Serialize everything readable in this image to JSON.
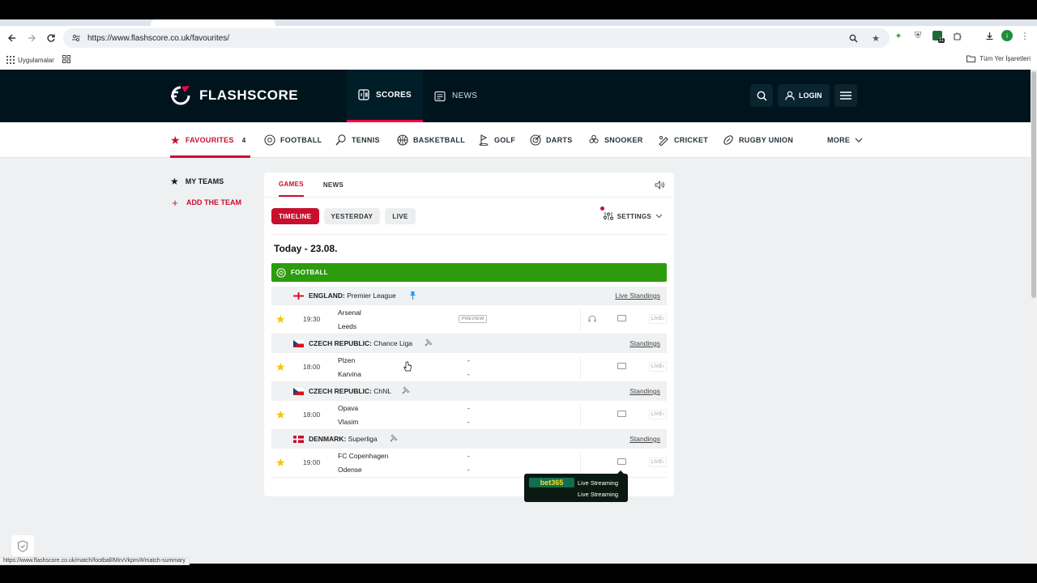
{
  "browser": {
    "url": "https://www.flashscore.co.uk/favourites/",
    "bookmarks_apps": "Uygulamalar",
    "bookmarks_all": "Tüm Yer İşaretleri",
    "extension_badge": "11",
    "profile_initial": "i",
    "status_url": "https://www.flashscore.co.uk/match/football/MirvVkpm/#/match-summary"
  },
  "header": {
    "logo_text": "FLASHSCORE",
    "nav": [
      {
        "label": "SCORES",
        "icon": "scoreboard-icon",
        "active": true
      },
      {
        "label": "NEWS",
        "icon": "news-icon",
        "active": false
      }
    ],
    "login_label": "LOGIN"
  },
  "sports": [
    {
      "label": "FAVOURITES",
      "icon": "star-icon",
      "count": "4"
    },
    {
      "label": "FOOTBALL",
      "icon": "football-icon"
    },
    {
      "label": "TENNIS",
      "icon": "tennis-icon"
    },
    {
      "label": "BASKETBALL",
      "icon": "basketball-icon"
    },
    {
      "label": "GOLF",
      "icon": "golf-icon"
    },
    {
      "label": "DARTS",
      "icon": "darts-icon"
    },
    {
      "label": "SNOOKER",
      "icon": "snooker-icon"
    },
    {
      "label": "CRICKET",
      "icon": "cricket-icon"
    },
    {
      "label": "RUGBY UNION",
      "icon": "rugby-icon"
    },
    {
      "label": "MORE",
      "icon": "chevron-down-icon"
    }
  ],
  "left_menu": {
    "my_teams": "MY TEAMS",
    "add_team": "ADD THE TEAM"
  },
  "panel": {
    "tabs": [
      "GAMES",
      "NEWS"
    ],
    "filters": [
      "TIMELINE",
      "YESTERDAY",
      "LIVE"
    ],
    "settings_label": "SETTINGS",
    "today": "Today - 23.08.",
    "sport_banner": "FOOTBALL",
    "preview_label": "PREVIEW",
    "live_label": "LIVE",
    "leagues": [
      {
        "country": "ENGLAND:",
        "name": "Premier League",
        "standings": "Live Standings",
        "pinned": true,
        "matches": [
          {
            "time": "19:30",
            "home": "Arsenal",
            "away": "Leeds",
            "score_home": "",
            "score_away": "",
            "preview": true,
            "audio": true
          }
        ]
      },
      {
        "country": "CZECH REPUBLIC:",
        "name": "Chance Liga",
        "standings": "Standings",
        "pinned": false,
        "matches": [
          {
            "time": "18:00",
            "home": "Plzen",
            "away": "Karvina",
            "score_home": "-",
            "score_away": "-",
            "preview": false,
            "audio": false
          }
        ]
      },
      {
        "country": "CZECH REPUBLIC:",
        "name": "ChNL",
        "standings": "Standings",
        "pinned": false,
        "matches": [
          {
            "time": "18:00",
            "home": "Opava",
            "away": "Vlasim",
            "score_home": "-",
            "score_away": "-",
            "preview": false,
            "audio": false
          }
        ]
      },
      {
        "country": "DENMARK:",
        "name": "Superliga",
        "standings": "Standings",
        "pinned": false,
        "matches": [
          {
            "time": "19:00",
            "home": "FC Copenhagen",
            "away": "Odense",
            "score_home": "-",
            "score_away": "-",
            "preview": false,
            "audio": false
          }
        ]
      }
    ]
  },
  "tooltip": {
    "brand": "bet365",
    "line1": "Live Streaming",
    "line2": "Live Streaming"
  },
  "colors": {
    "brand_red": "#c8102e",
    "header_bg": "#00141e",
    "football_green": "#2c9c0e",
    "star_yellow": "#f5c400"
  }
}
